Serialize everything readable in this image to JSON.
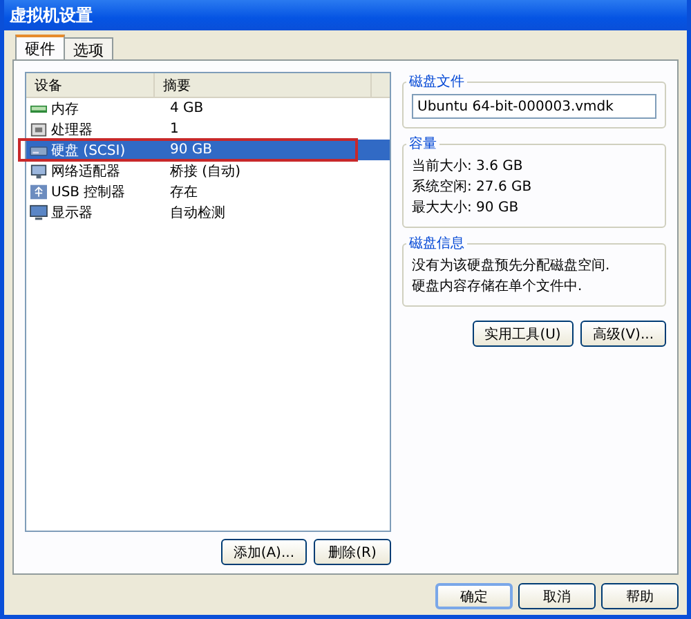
{
  "window": {
    "title": "虚拟机设置"
  },
  "tabs": [
    {
      "label": "硬件",
      "selected": true
    },
    {
      "label": "选项",
      "selected": false
    }
  ],
  "device_table": {
    "columns": [
      "设备",
      "摘要"
    ],
    "rows": [
      {
        "kind": "memory",
        "device": "内存",
        "summary": "4 GB",
        "selected": false,
        "highlighted": false
      },
      {
        "kind": "cpu",
        "device": "处理器",
        "summary": "1",
        "selected": false,
        "highlighted": false
      },
      {
        "kind": "disk",
        "device": "硬盘 (SCSI)",
        "summary": "90 GB",
        "selected": true,
        "highlighted": true
      },
      {
        "kind": "network",
        "device": "网络适配器",
        "summary": "桥接 (自动)",
        "selected": false,
        "highlighted": false
      },
      {
        "kind": "usb",
        "device": "USB 控制器",
        "summary": "存在",
        "selected": false,
        "highlighted": false
      },
      {
        "kind": "display",
        "device": "显示器",
        "summary": "自动检测",
        "selected": false,
        "highlighted": false
      }
    ]
  },
  "list_buttons": [
    "添加(A)...",
    "删除(R)"
  ],
  "disk_file": {
    "title": "磁盘文件",
    "value": "Ubuntu 64-bit-000003.vmdk"
  },
  "capacity": {
    "title": "容量",
    "lines": [
      "当前大小: 3.6 GB",
      "系统空闲: 27.6 GB",
      "最大大小: 90 GB"
    ]
  },
  "disk_info": {
    "title": "磁盘信息",
    "lines": [
      "没有为该硬盘预先分配磁盘空间.",
      "硬盘内容存储在单个文件中."
    ]
  },
  "disk_buttons": [
    "实用工具(U)",
    "高级(V)..."
  ],
  "dialog_buttons": [
    {
      "label": "确定",
      "default": true
    },
    {
      "label": "取消",
      "default": false
    },
    {
      "label": "帮助",
      "default": false
    }
  ]
}
